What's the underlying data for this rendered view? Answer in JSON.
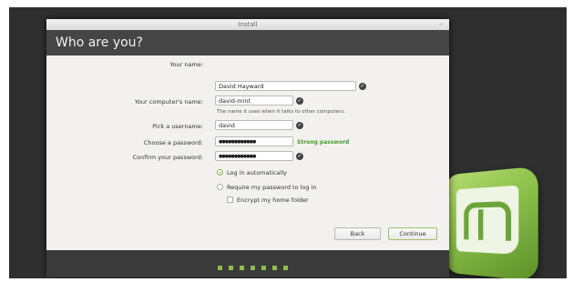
{
  "window": {
    "title": "Install",
    "minimize_glyph": "–"
  },
  "header": {
    "title": "Who are you?"
  },
  "form": {
    "name_label": "Your name:",
    "name_value": "David Hayward",
    "computer_label": "Your computer's name:",
    "computer_value": "david-mint",
    "computer_hint": "The name it uses when it talks to other computers.",
    "username_label": "Pick a username:",
    "username_value": "david",
    "password_label": "Choose a password:",
    "password_value": "●●●●●●●●●●●●",
    "password_strength": "Strong password",
    "confirm_label": "Confirm your password:",
    "confirm_value": "●●●●●●●●●●●●",
    "opt_auto_login": "Log in automatically",
    "opt_require_password": "Require my password to log in",
    "opt_encrypt_home": "Encrypt my home folder",
    "selected_option": "Log in automatically",
    "check_glyph": "✓"
  },
  "buttons": {
    "back": "Back",
    "continue": "Continue"
  },
  "progress": {
    "total_steps": 7
  },
  "colors": {
    "accent": "#8cbd4e",
    "strong": "#4b9b2a",
    "header_bg": "#454545"
  },
  "icons": [
    "check-icon",
    "linux-mint-logo"
  ]
}
